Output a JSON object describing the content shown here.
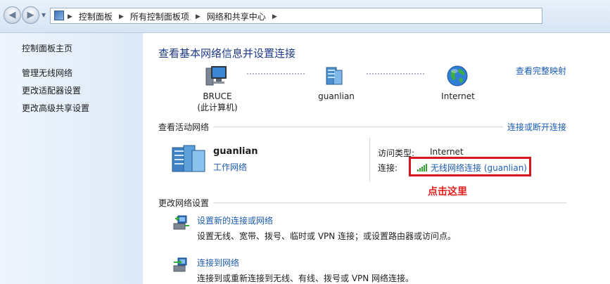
{
  "address_bar": {
    "breadcrumb": [
      "控制面板",
      "所有控制面板项",
      "网络和共享中心"
    ]
  },
  "sidebar": {
    "items": [
      {
        "label": "控制面板主页"
      },
      {
        "label": "管理无线网络"
      },
      {
        "label": "更改适配器设置"
      },
      {
        "label": "更改高级共享设置"
      }
    ]
  },
  "main": {
    "title": "查看基本网络信息并设置连接",
    "full_map_link": "查看完整映射",
    "map_nodes": [
      {
        "name": "BRUCE",
        "sub": "(此计算机)",
        "icon": "computer-icon"
      },
      {
        "name": "guanlian",
        "sub": "",
        "icon": "network-icon"
      },
      {
        "name": "Internet",
        "sub": "",
        "icon": "globe-icon"
      }
    ],
    "active_networks": {
      "section_label": "查看活动网络",
      "connect_link": "连接或断开连接",
      "network_name": "guanlian",
      "network_type": "工作网络",
      "access_type_label": "访问类型:",
      "access_type_value": "Internet",
      "connection_label": "连接:",
      "connection_value": "无线网络连接 (guanlian)",
      "callout": "点击这里"
    },
    "change_settings": {
      "section_label": "更改网络设置",
      "tasks": [
        {
          "title": "设置新的连接或网络",
          "desc": "设置无线、宽带、拨号、临时或 VPN 连接；或设置路由器或访问点。",
          "icon": "new-connection-icon"
        },
        {
          "title": "连接到网络",
          "desc": "连接到或重新连接到无线、有线、拨号或 VPN 网络连接。",
          "icon": "connect-network-icon"
        }
      ]
    }
  },
  "colors": {
    "link": "#1c5cb2",
    "title": "#1e3a8a",
    "highlight": "#d4181e"
  }
}
